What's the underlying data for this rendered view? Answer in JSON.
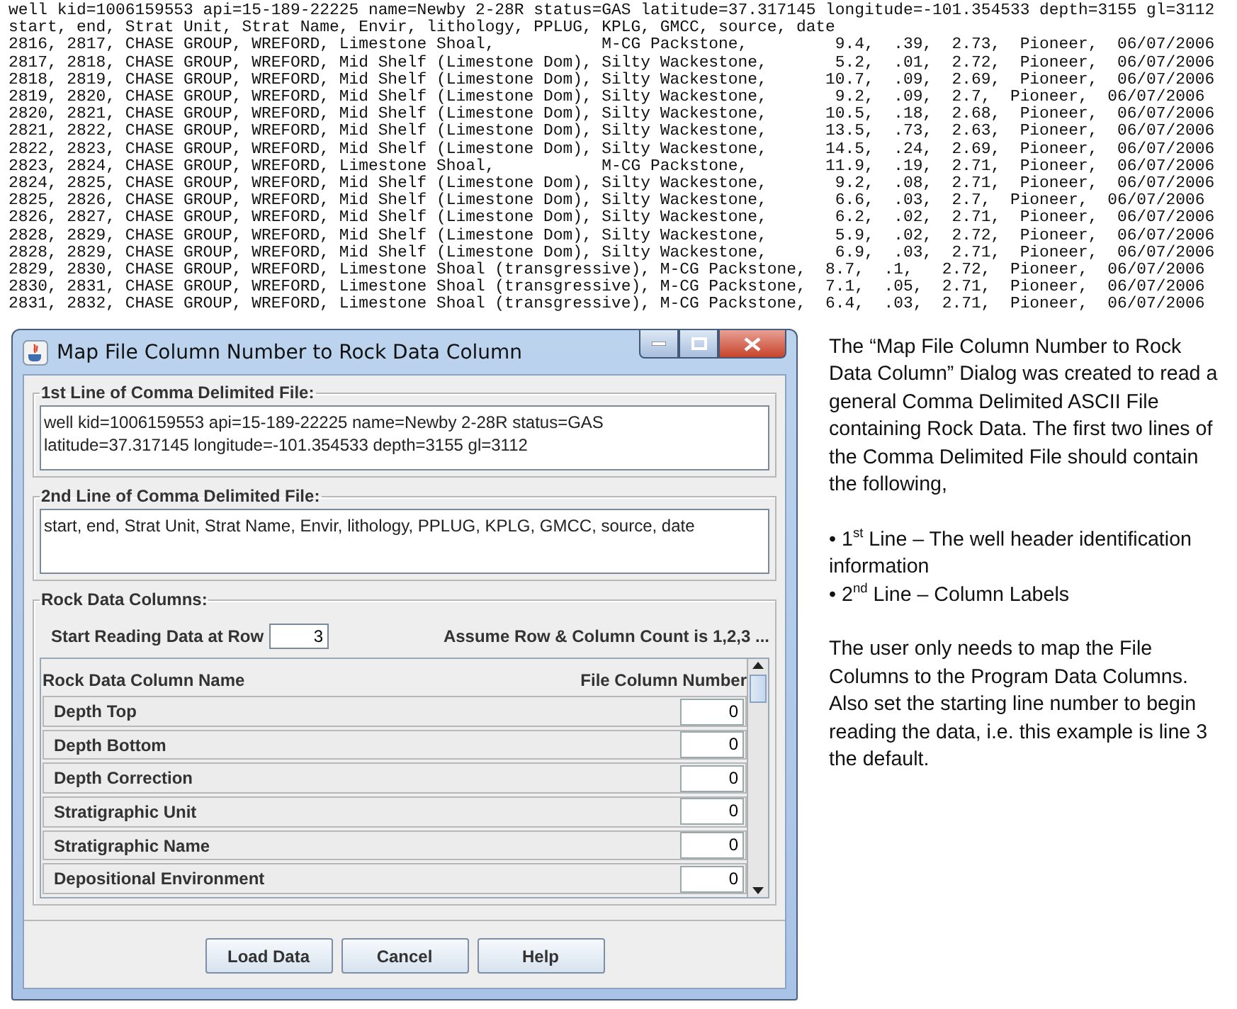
{
  "file_listing": {
    "lines": [
      "well kid=1006159553 api=15-189-22225 name=Newby 2-28R status=GAS latitude=37.317145 longitude=-101.354533 depth=3155 gl=3112",
      "start, end, Strat Unit, Strat Name, Envir, lithology, PPLUG, KPLG, GMCC, source, date",
      "2816, 2817, CHASE GROUP, WREFORD, Limestone Shoal,           M-CG Packstone,         9.4,  .39,  2.73,  Pioneer,  06/07/2006",
      "2817, 2818, CHASE GROUP, WREFORD, Mid Shelf (Limestone Dom), Silty Wackestone,       5.2,  .01,  2.72,  Pioneer,  06/07/2006",
      "2818, 2819, CHASE GROUP, WREFORD, Mid Shelf (Limestone Dom), Silty Wackestone,      10.7,  .09,  2.69,  Pioneer,  06/07/2006",
      "2819, 2820, CHASE GROUP, WREFORD, Mid Shelf (Limestone Dom), Silty Wackestone,       9.2,  .09,  2.7,  Pioneer,  06/07/2006",
      "2820, 2821, CHASE GROUP, WREFORD, Mid Shelf (Limestone Dom), Silty Wackestone,      10.5,  .18,  2.68,  Pioneer,  06/07/2006",
      "2821, 2822, CHASE GROUP, WREFORD, Mid Shelf (Limestone Dom), Silty Wackestone,      13.5,  .73,  2.63,  Pioneer,  06/07/2006",
      "2822, 2823, CHASE GROUP, WREFORD, Mid Shelf (Limestone Dom), Silty Wackestone,      14.5,  .24,  2.69,  Pioneer,  06/07/2006",
      "2823, 2824, CHASE GROUP, WREFORD, Limestone Shoal,           M-CG Packstone,        11.9,  .19,  2.71,  Pioneer,  06/07/2006",
      "2824, 2825, CHASE GROUP, WREFORD, Mid Shelf (Limestone Dom), Silty Wackestone,       9.2,  .08,  2.71,  Pioneer,  06/07/2006",
      "2825, 2826, CHASE GROUP, WREFORD, Mid Shelf (Limestone Dom), Silty Wackestone,       6.6,  .03,  2.7,  Pioneer,  06/07/2006",
      "2826, 2827, CHASE GROUP, WREFORD, Mid Shelf (Limestone Dom), Silty Wackestone,       6.2,  .02,  2.71,  Pioneer,  06/07/2006",
      "2828, 2829, CHASE GROUP, WREFORD, Mid Shelf (Limestone Dom), Silty Wackestone,       5.9,  .02,  2.72,  Pioneer,  06/07/2006",
      "2828, 2829, CHASE GROUP, WREFORD, Mid Shelf (Limestone Dom), Silty Wackestone,       6.9,  .03,  2.71,  Pioneer,  06/07/2006",
      "2829, 2830, CHASE GROUP, WREFORD, Limestone Shoal (transgressive), M-CG Packstone,  8.7,  .1,   2.72,  Pioneer,  06/07/2006",
      "2830, 2831, CHASE GROUP, WREFORD, Limestone Shoal (transgressive), M-CG Packstone,  7.1,  .05,  2.71,  Pioneer,  06/07/2006",
      "2831, 2832, CHASE GROUP, WREFORD, Limestone Shoal (transgressive), M-CG Packstone,  6.4,  .03,  2.71,  Pioneer,  06/07/2006"
    ]
  },
  "dialog": {
    "title": "Map File Column Number to Rock Data Column",
    "first_line": {
      "label": "1st Line of Comma Delimited File:",
      "lines": [
        "well kid=1006159553 api=15-189-22225 name=Newby 2-28R status=GAS",
        "latitude=37.317145 longitude=-101.354533 depth=3155 gl=3112"
      ]
    },
    "second_line": {
      "label": "2nd Line of Comma Delimited File:",
      "lines": [
        "start, end, Strat Unit, Strat Name, Envir, lithology, PPLUG, KPLG, GMCC, source, date"
      ]
    },
    "rock_data_columns": {
      "label": "Rock Data Columns:",
      "start_row_label": "Start Reading Data at Row",
      "start_row_value": "3",
      "note": "Assume Row & Column Count is 1,2,3 ...",
      "columns": [
        "Rock Data Column Name",
        "File Column Number"
      ],
      "rows": [
        {
          "name": "Depth Top",
          "value": "0"
        },
        {
          "name": "Depth Bottom",
          "value": "0"
        },
        {
          "name": "Depth Correction",
          "value": "0"
        },
        {
          "name": "Stratigraphic Unit",
          "value": "0"
        },
        {
          "name": "Stratigraphic Name",
          "value": "0"
        },
        {
          "name": "Depositional Environment",
          "value": "0"
        }
      ]
    },
    "buttons": [
      "Load Data",
      "Cancel",
      "Help"
    ]
  },
  "description": {
    "intro": "The “Map File Column Number to Rock Data Column” Dialog was created to read a general Comma Delimited ASCII File containing Rock Data.  The first two lines of the Comma Delimited File should contain the following,",
    "bullets": [
      "• 1$^{st}$ Line – The well header identification information",
      "• 2$^{nd}$ Line – Column Labels"
    ],
    "outro": "The user only needs to map the File Columns to the Program Data Columns. Also set the starting line number to begin reading the data, i.e. this example is line 3 the default."
  }
}
